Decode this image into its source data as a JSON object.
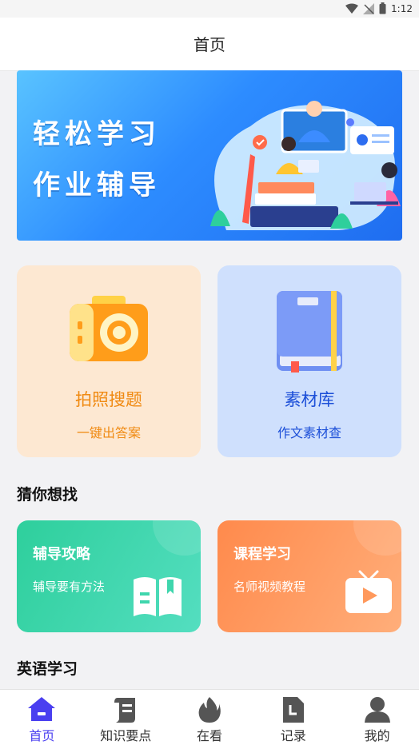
{
  "status_bar": {
    "time": "1:12"
  },
  "header": {
    "title": "首页"
  },
  "banner": {
    "line1": "轻松学习",
    "line2": "作业辅导"
  },
  "features": [
    {
      "title": "拍照搜题",
      "subtitle": "一键出答案"
    },
    {
      "title": "素材库",
      "subtitle": "作文素材查"
    }
  ],
  "sections": {
    "guess": "猜你想找",
    "english": "英语学习"
  },
  "guess_cards": [
    {
      "title": "辅导攻略",
      "subtitle": "辅导要有方法"
    },
    {
      "title": "课程学习",
      "subtitle": "名师视频教程"
    }
  ],
  "bottom_nav": [
    {
      "label": "首页",
      "icon": "home-icon",
      "active": true
    },
    {
      "label": "知识要点",
      "icon": "scroll-icon",
      "active": false
    },
    {
      "label": "在看",
      "icon": "flame-icon",
      "active": false
    },
    {
      "label": "记录",
      "icon": "document-icon",
      "active": false
    },
    {
      "label": "我的",
      "icon": "user-icon",
      "active": false
    }
  ],
  "colors": {
    "accent": "#4a3ff0",
    "orange": "#f08a12",
    "blue": "#1c4fd8"
  }
}
